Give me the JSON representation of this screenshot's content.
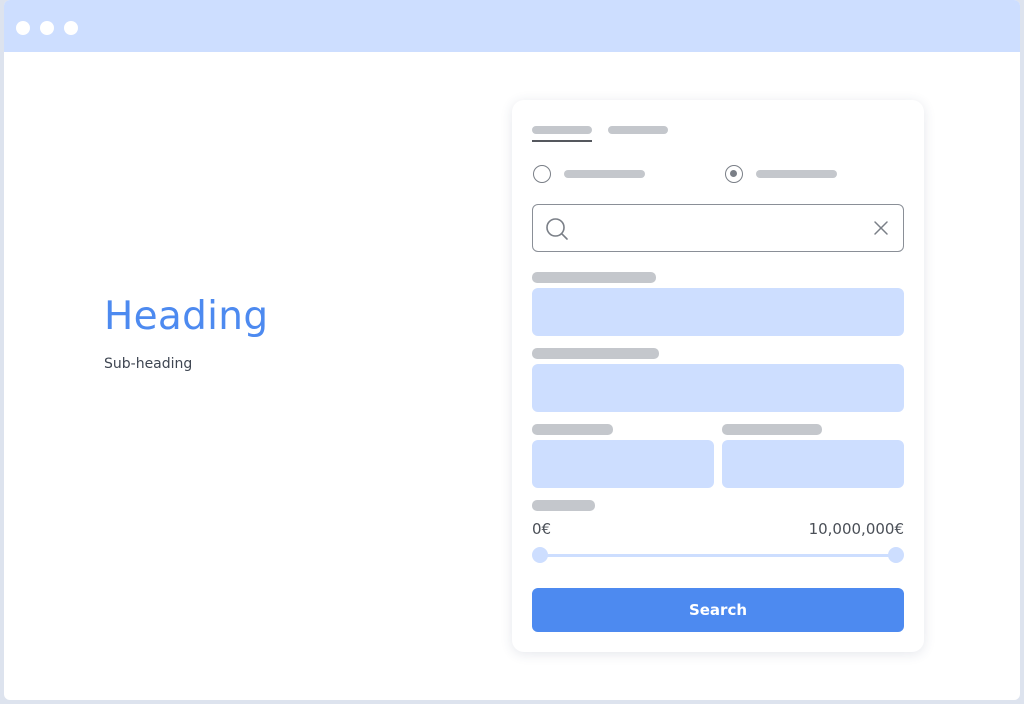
{
  "window": {
    "titlebar_color": "#cddeff"
  },
  "hero": {
    "heading": "Heading",
    "subheading": "Sub-heading"
  },
  "search_form": {
    "tabs": [
      {
        "selected": true
      },
      {
        "selected": false
      }
    ],
    "radio_options": [
      {
        "checked": false
      },
      {
        "checked": true
      }
    ],
    "search": {
      "value": "",
      "icon": "search-icon",
      "clear_icon": "close-icon"
    },
    "price_range": {
      "min_label": "0€",
      "max_label": "10,000,000€",
      "min_value": 0,
      "max_value": 10000000
    },
    "submit_label": "Search"
  },
  "colors": {
    "accent": "#4d8af0",
    "field_fill": "#cddeff",
    "placeholder_bar": "#c4c7cc"
  }
}
